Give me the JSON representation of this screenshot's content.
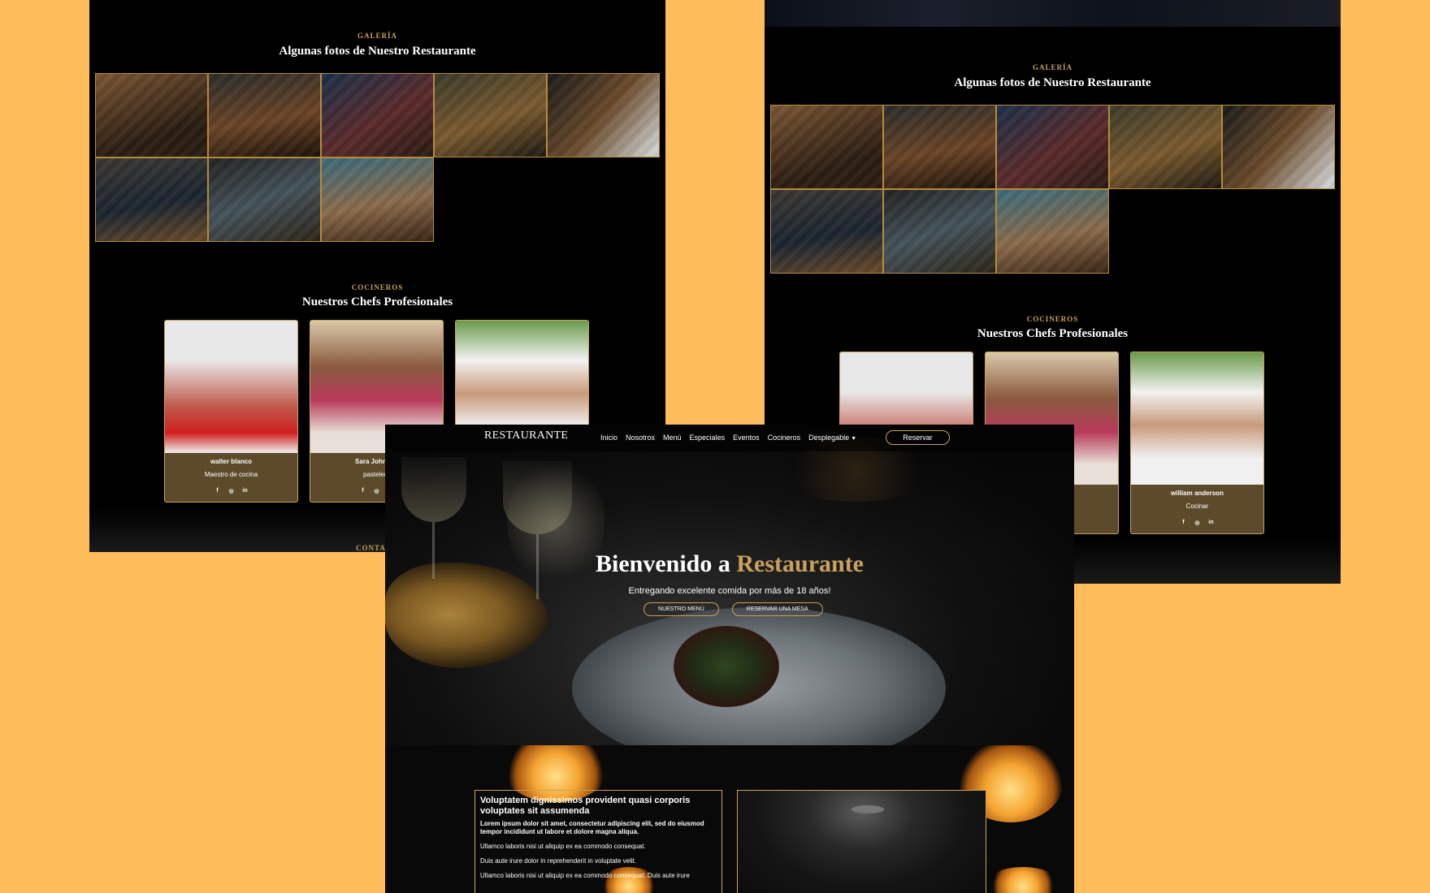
{
  "left_panel": {
    "gallery_kicker": "GALERÍA",
    "gallery_title": "Algunas fotos de Nuestro Restaurante",
    "chefs_kicker": "COCINEROS",
    "chefs_title": "Nuestros Chefs Profesionales",
    "chefs": [
      {
        "name": "walter blanco",
        "role": "Maestro de cocina"
      },
      {
        "name": "Sara Johnson",
        "role": "pastelero"
      }
    ],
    "contact_label": "CONTACTO"
  },
  "right_panel": {
    "gallery_kicker": "GALERÍA",
    "gallery_title": "Algunas fotos de Nuestro Restaurante",
    "chefs_kicker": "COCINEROS",
    "chefs_title": "Nuestros Chefs Profesionales",
    "chefs": [
      {
        "name": "william anderson",
        "role": "Cocinar"
      }
    ]
  },
  "social": {
    "facebook": "f",
    "instagram": "◎",
    "linkedin": "in"
  },
  "gallery_photos": [
    {
      "name": "dining-room",
      "color": "#5a3d22"
    },
    {
      "name": "bar-chalkboard",
      "color": "#4a3220"
    },
    {
      "name": "neon-bar",
      "color": "#3a2a3a"
    },
    {
      "name": "cafe-interior",
      "color": "#4a4028"
    },
    {
      "name": "table-overhead",
      "color": "#3b2a1c"
    },
    {
      "name": "server-at-bar",
      "color": "#3a3430"
    },
    {
      "name": "friends-dining",
      "color": "#2e3a40"
    },
    {
      "name": "outdoor-feast",
      "color": "#4a3828"
    }
  ],
  "front": {
    "brand": "RESTAURANTE",
    "nav": [
      "Inicio",
      "Nosotros",
      "Menú",
      "Especiales",
      "Eventos",
      "Cocineros",
      "Desplegable"
    ],
    "reserve_button": "Reservar",
    "hero_title_prefix": "Bienvenido a ",
    "hero_title_accent": "Restaurante",
    "hero_subtitle": "Entregando excelente comida por más de 18 años!",
    "hero_buttons": [
      "NUESTRO MENÚ",
      "RESERVAR UNA MESA"
    ],
    "about_heading": "Voluptatem dignissimos provident quasi corporis voluptates sit assumenda",
    "about_lead": "Lorem ipsum dolor sit amet, consectetur adipiscing elit, sed do eiusmod tempor incididunt ut labore et dolore magna aliqua.",
    "about_p1": "Ullamco laboris nisi ut aliquip ex ea commodo consequat.",
    "about_p2": "Duis aute irure dolor in reprehenderit in voluptate velit.",
    "about_p3": "Ullamco laboris nisi ut aliquip ex ea commodo consequat. Duis aute irure"
  },
  "colors": {
    "background": "#ffbc5b",
    "accent": "#c9a15d",
    "panel": "#000000",
    "card": "#5c4a2b"
  }
}
